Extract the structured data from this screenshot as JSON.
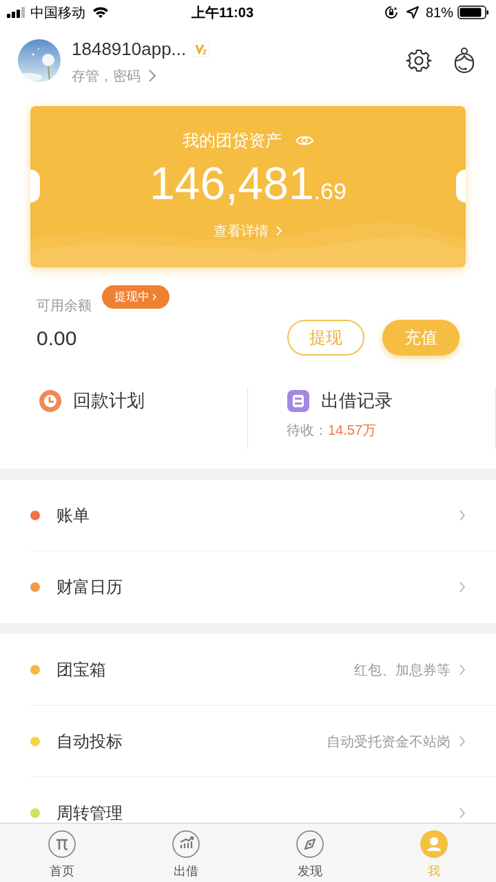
{
  "status_bar": {
    "carrier": "中国移动",
    "time": "上午11:03",
    "battery": "81%"
  },
  "profile": {
    "name": "1848910app...",
    "subtitle": "存管，密码"
  },
  "asset_card": {
    "title": "我的团贷资产",
    "amount_integer": "146,481",
    "amount_decimal": ".69",
    "link": "查看详情"
  },
  "balance": {
    "label": "可用余额",
    "badge": "提现中",
    "value": "0.00",
    "buttons": [
      {
        "label": "提现",
        "kind": "outline"
      },
      {
        "label": "充值",
        "kind": "filled"
      }
    ]
  },
  "shortcuts": [
    {
      "label": "回款计划",
      "kind": "clock"
    },
    {
      "label": "出借记录",
      "kind": "record",
      "note_label": "待收：",
      "note_value": "14.57万"
    }
  ],
  "menu_groups": [
    [
      {
        "label": "账单",
        "color": "#f0734a"
      },
      {
        "label": "财富日历",
        "color": "#f29a4a"
      }
    ],
    [
      {
        "label": "团宝箱",
        "color": "#f5b942",
        "hint": "红包、加息券等"
      },
      {
        "label": "自动投标",
        "color": "#f7d443",
        "hint": "自动受托资金不站岗"
      },
      {
        "label": "周转管理",
        "color": "#cbe65a"
      }
    ]
  ],
  "tab_bar": [
    {
      "label": "首页",
      "kind": "home",
      "selected": false
    },
    {
      "label": "出借",
      "kind": "lend",
      "selected": false
    },
    {
      "label": "发现",
      "kind": "discover",
      "selected": false
    },
    {
      "label": "我",
      "kind": "me",
      "selected": true
    }
  ]
}
